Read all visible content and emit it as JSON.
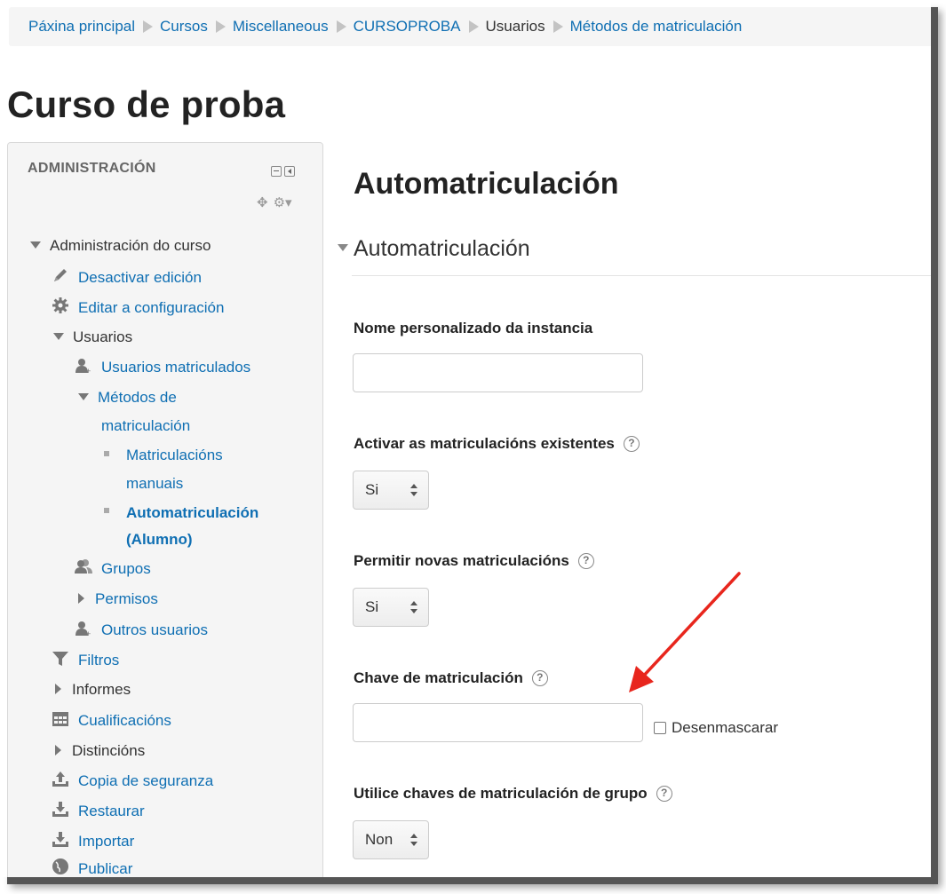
{
  "breadcrumb": {
    "items": [
      "Páxina principal",
      "Cursos",
      "Miscellaneous",
      "CURSOPROBA",
      "Usuarios",
      "Métodos de matriculación"
    ]
  },
  "course_title": "Curso de proba",
  "admin": {
    "title": "ADMINISTRACIÓN",
    "items": {
      "course_admin": "Administración do curso",
      "disable_edit": "Desactivar edición",
      "edit_config": "Editar a configuración",
      "users": "Usuarios",
      "enrolled_users": "Usuarios matriculados",
      "enrol_methods_1": "Métodos de",
      "enrol_methods_2": "matriculación",
      "manual_1": "Matriculacións",
      "manual_2": "manuais",
      "self_1": "Automatriculación",
      "self_2": "(Alumno)",
      "groups": "Grupos",
      "permissions": "Permisos",
      "other_users": "Outros usuarios",
      "filters": "Filtros",
      "reports": "Informes",
      "grades": "Cualificacións",
      "badges": "Distincións",
      "backup": "Copia de seguranza",
      "restore": "Restaurar",
      "import": "Importar",
      "publish": "Publicar"
    }
  },
  "main": {
    "heading": "Automatriculación",
    "legend": "Automatriculación",
    "fields": {
      "instance_name": {
        "label": "Nome personalizado da instancia",
        "value": ""
      },
      "enable_existing": {
        "label": "Activar as matriculacións existentes",
        "value": "Si"
      },
      "allow_new": {
        "label": "Permitir novas matriculacións",
        "value": "Si"
      },
      "enrol_key": {
        "label": "Chave de matriculación",
        "value": "",
        "unmask_label": "Desenmascarar"
      },
      "group_keys": {
        "label": "Utilice chaves de matriculación de grupo",
        "value": "Non"
      }
    },
    "help_glyph": "?"
  },
  "colors": {
    "link": "#0f6fb3",
    "annotation_arrow": "#e8261d"
  }
}
